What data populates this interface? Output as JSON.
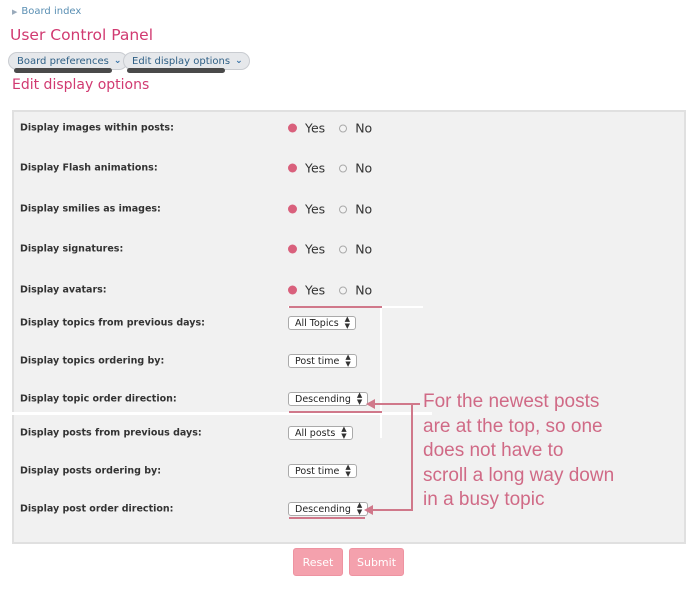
{
  "breadcrumb": {
    "label": "Board index"
  },
  "page_title": "User Control Panel",
  "nav": {
    "board_preferences": "Board preferences",
    "edit_display_options": "Edit display options"
  },
  "section_title": "Edit display options",
  "radio_rows": [
    {
      "label": "Display images within posts:",
      "yes": "Yes",
      "no": "No",
      "selected": "Yes"
    },
    {
      "label": "Display Flash animations:",
      "yes": "Yes",
      "no": "No",
      "selected": "Yes"
    },
    {
      "label": "Display smilies as images:",
      "yes": "Yes",
      "no": "No",
      "selected": "Yes"
    },
    {
      "label": "Display signatures:",
      "yes": "Yes",
      "no": "No",
      "selected": "Yes"
    },
    {
      "label": "Display avatars:",
      "yes": "Yes",
      "no": "No",
      "selected": "Yes"
    }
  ],
  "select_rows": [
    {
      "label": "Display topics from previous days:",
      "value": "All Topics"
    },
    {
      "label": "Display topics ordering by:",
      "value": "Post time"
    },
    {
      "label": "Display topic order direction:",
      "value": "Descending"
    },
    {
      "label": "Display posts from previous days:",
      "value": "All posts"
    },
    {
      "label": "Display posts ordering by:",
      "value": "Post time"
    },
    {
      "label": "Display post order direction:",
      "value": "Descending"
    }
  ],
  "buttons": {
    "reset": "Reset",
    "submit": "Submit"
  },
  "annotation": [
    "For the newest posts",
    "are at the top, so one",
    "does not have to",
    "scroll a long way down",
    "in a busy topic"
  ],
  "colors": {
    "accent": "#d13a71",
    "radio_on": "#d9607c",
    "button": "#f4a1ad",
    "annotation": "#d06a86"
  }
}
